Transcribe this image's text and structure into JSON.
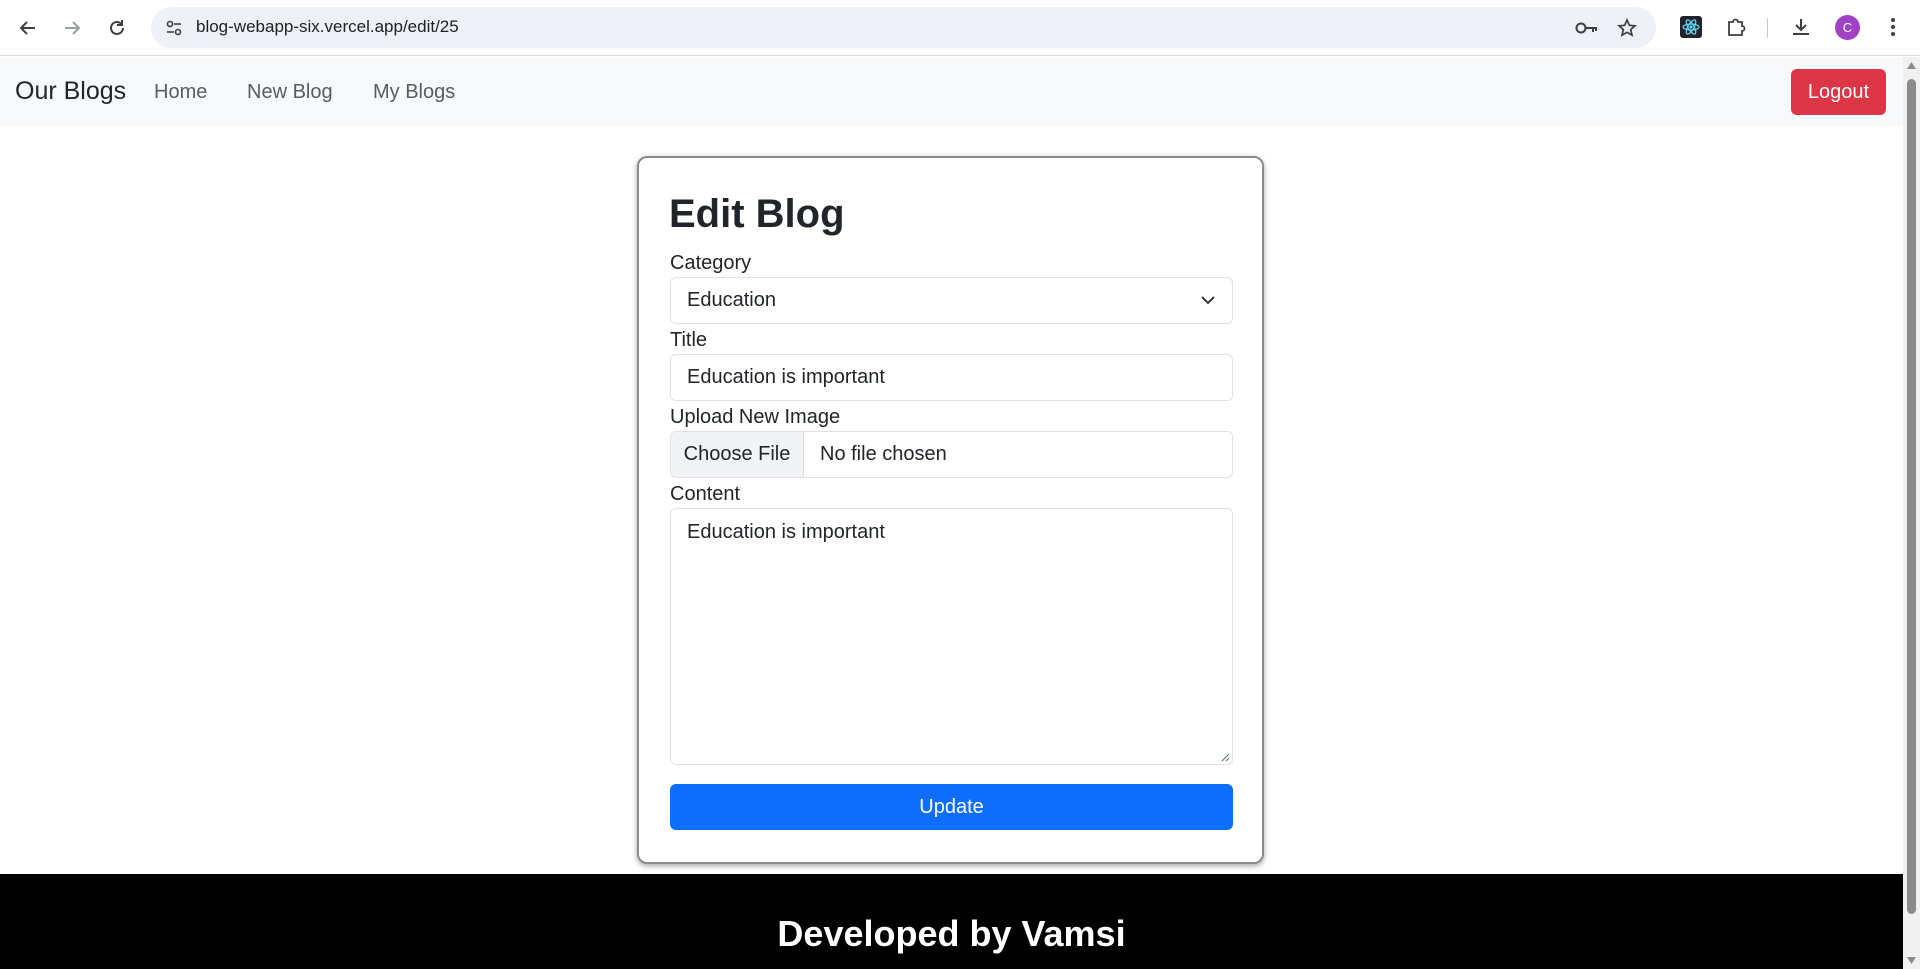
{
  "browser": {
    "url": "blog-webapp-six.vercel.app/edit/25",
    "avatar_letter": "C"
  },
  "navbar": {
    "brand": "Our Blogs",
    "links": [
      "Home",
      "New Blog",
      "My Blogs"
    ],
    "logout": "Logout"
  },
  "form": {
    "heading": "Edit Blog",
    "category_label": "Category",
    "category_value": "Education",
    "title_label": "Title",
    "title_value": "Education is important",
    "image_label": "Upload New Image",
    "choose_file": "Choose File",
    "file_status": "No file chosen",
    "content_label": "Content",
    "content_value": "Education is important",
    "submit": "Update"
  },
  "footer": {
    "text": "Developed by Vamsi"
  },
  "colors": {
    "logout": "#dc3545",
    "primary": "#0d6efd",
    "footer_bg": "#000000",
    "avatar": "#a142c4"
  }
}
